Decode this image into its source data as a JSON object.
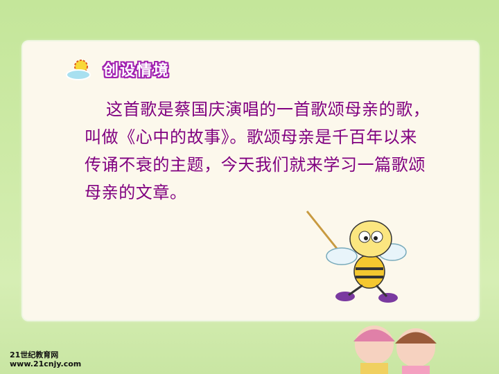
{
  "slide": {
    "title": "创设情境",
    "title_icon": "sun-cloud-icon",
    "body": "这首歌是蔡国庆演唱的一首歌颂母亲的歌，叫做《心中的故事》。歌颂母亲是千百年以来传诵不衰的主题，今天我们就来学习一篇歌颂母亲的文章。"
  },
  "watermark": {
    "line1": "21世纪教育网",
    "line2": "www.21cnjy.com"
  },
  "colors": {
    "text": "#800080",
    "title_outline": "#a020b0",
    "card": "#fcf8ec",
    "background": "#c9e6a3"
  }
}
